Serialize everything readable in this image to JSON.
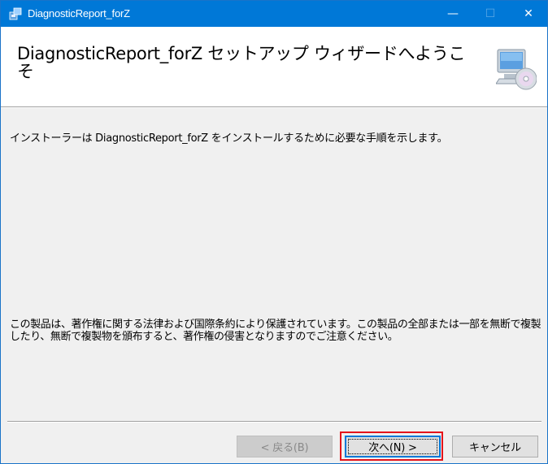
{
  "window": {
    "title": "DiagnosticReport_forZ",
    "controls": {
      "minimize": "—",
      "maximize": "☐",
      "close": "✕"
    }
  },
  "header": {
    "title": "DiagnosticReport_forZ セットアップ ウィザードへようこそ",
    "icon": "computer-cd-icon"
  },
  "body": {
    "intro": "インストーラーは DiagnosticReport_forZ をインストールするために必要な手順を示します。",
    "legal": "この製品は、著作権に関する法律および国際条約により保護されています。この製品の全部または一部を無断で複製したり、無断で複製物を頒布すると、著作権の侵害となりますのでご注意ください。"
  },
  "buttons": {
    "back": "< 戻る(B)",
    "next": "次へ(N) >",
    "cancel": "キャンセル"
  },
  "colors": {
    "titlebar": "#0078d7",
    "highlight": "#e4141b"
  }
}
